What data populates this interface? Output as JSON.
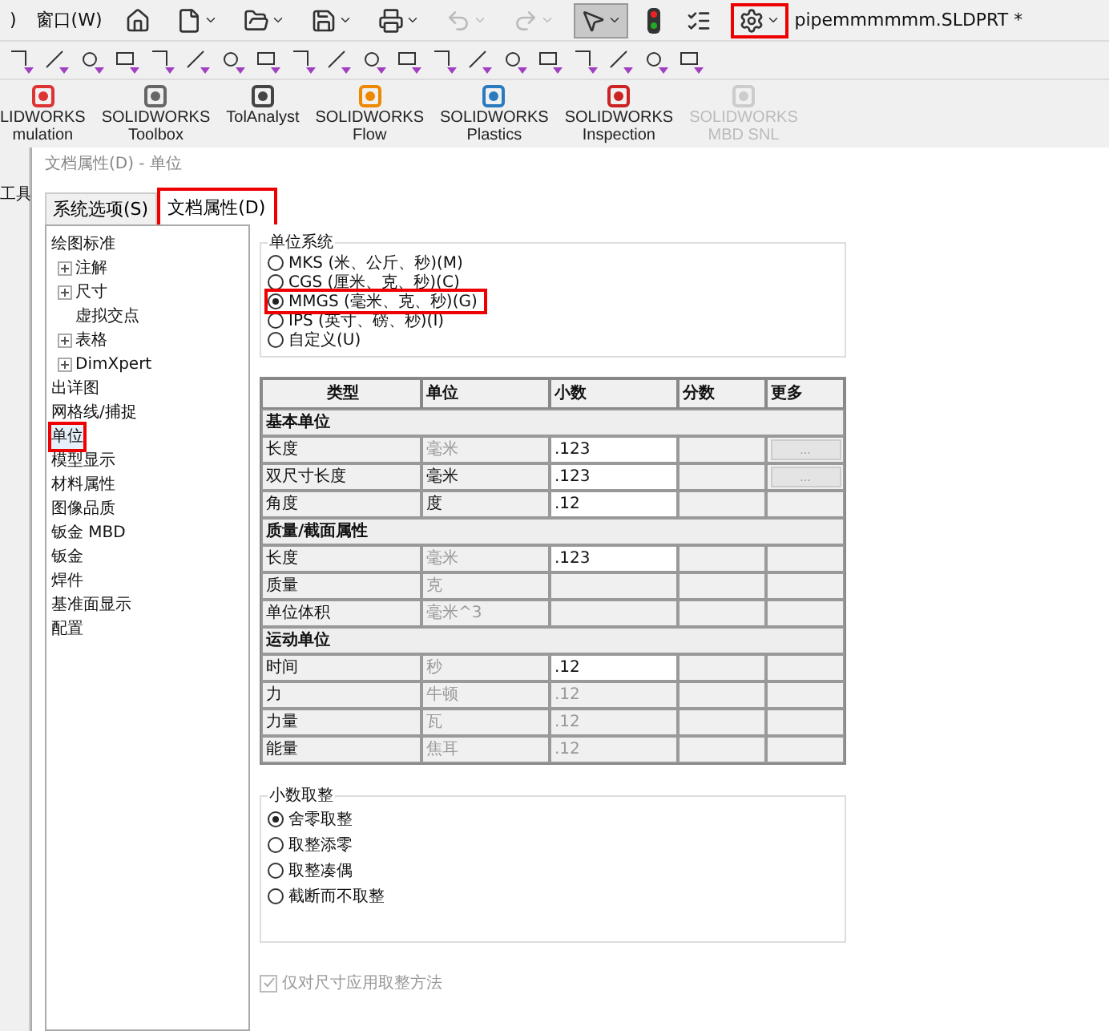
{
  "menu": [
    {
      "label": ")"
    },
    {
      "label": "窗口(W)"
    }
  ],
  "toolbar": {
    "buttons": [
      {
        "kind": "home"
      },
      {
        "kind": "file",
        "dropdown": true
      },
      {
        "kind": "open",
        "dropdown": true
      },
      {
        "kind": "save",
        "dropdown": true
      },
      {
        "kind": "print",
        "dropdown": true
      },
      {
        "kind": "undo",
        "dropdown": true,
        "disabled": true
      },
      {
        "kind": "redo",
        "dropdown": true,
        "disabled": true
      },
      {
        "kind": "select",
        "dropdown": true,
        "pressed": true
      },
      {
        "kind": "traffic"
      },
      {
        "kind": "list"
      },
      {
        "kind": "settings",
        "dropdown": true,
        "highlighted": true
      }
    ]
  },
  "document_title": "pipemmmmmm.SLDPRT *",
  "commands": [
    {
      "line1": "LIDWORKS",
      "line2": "mulation",
      "disabled": false
    },
    {
      "line1": "SOLIDWORKS",
      "line2": "Toolbox",
      "disabled": false
    },
    {
      "line1": "TolAnalyst",
      "disabled": false
    },
    {
      "line1": "SOLIDWORKS",
      "line2": "Flow",
      "disabled": false
    },
    {
      "line1": "SOLIDWORKS",
      "line2": "Plastics",
      "disabled": false
    },
    {
      "line1": "SOLIDWORKS",
      "line2": "Inspection",
      "disabled": false
    },
    {
      "line1": "SOLIDWORKS",
      "line2": "MBD SNL",
      "disabled": true
    }
  ],
  "side_tab": "工具",
  "dialog": {
    "title": "文档属性(D) - 单位",
    "tabs": [
      {
        "label": "系统选项(S)",
        "selected": false,
        "highlighted": false
      },
      {
        "label": "文档属性(D)",
        "selected": true,
        "highlighted": true
      }
    ],
    "tree": [
      {
        "label": "绘图标准",
        "selected": false,
        "highlighted": false,
        "children": [
          {
            "label": "注解",
            "expandable": true
          },
          {
            "label": "尺寸",
            "expandable": true
          },
          {
            "label": "虚拟交点",
            "expandable": false
          },
          {
            "label": "表格",
            "expandable": true
          },
          {
            "label": "DimXpert",
            "expandable": true
          }
        ]
      },
      {
        "label": "出详图",
        "selected": false,
        "highlighted": false
      },
      {
        "label": "网格线/捕捉",
        "selected": false,
        "highlighted": false
      },
      {
        "label": "单位",
        "selected": true,
        "highlighted": true
      },
      {
        "label": "模型显示",
        "selected": false,
        "highlighted": false
      },
      {
        "label": "材料属性",
        "selected": false,
        "highlighted": false
      },
      {
        "label": "图像品质",
        "selected": false,
        "highlighted": false
      },
      {
        "label": "钣金 MBD",
        "selected": false,
        "highlighted": false
      },
      {
        "label": "钣金",
        "selected": false,
        "highlighted": false
      },
      {
        "label": "焊件",
        "selected": false,
        "highlighted": false
      },
      {
        "label": "基准面显示",
        "selected": false,
        "highlighted": false
      },
      {
        "label": "配置",
        "selected": false,
        "highlighted": false
      }
    ],
    "unit_system": {
      "title": "单位系统",
      "options": [
        {
          "label": "MKS (米、公斤、秒)(M)",
          "selected": false,
          "highlighted": false
        },
        {
          "label": "CGS (厘米、克、秒)(C)",
          "selected": false,
          "highlighted": false
        },
        {
          "label": "MMGS (毫米、克、秒)(G)",
          "selected": true,
          "highlighted": true
        },
        {
          "label": "IPS (英寸、磅、秒)(I)",
          "selected": false,
          "highlighted": false
        },
        {
          "label": "自定义(U)",
          "selected": false,
          "highlighted": false
        }
      ]
    },
    "table": {
      "columns": [
        "类型",
        "单位",
        "小数",
        "分数",
        "更多"
      ],
      "rows": [
        {
          "kind": "section",
          "label": "基本单位"
        },
        {
          "kind": "row",
          "type": "长度",
          "unit": "毫米",
          "unit_disabled": true,
          "decimal": ".123",
          "decimal_editable": true,
          "more_button": "..."
        },
        {
          "kind": "row",
          "type": "双尺寸长度",
          "unit": "毫米",
          "unit_disabled": false,
          "decimal": ".123",
          "decimal_editable": true,
          "more_button": "..."
        },
        {
          "kind": "row",
          "type": "角度",
          "unit": "度",
          "unit_disabled": false,
          "decimal": ".12",
          "decimal_editable": true
        },
        {
          "kind": "section",
          "label": "质量/截面属性"
        },
        {
          "kind": "row",
          "type": "长度",
          "unit": "毫米",
          "unit_disabled": true,
          "decimal": ".123",
          "decimal_editable": true
        },
        {
          "kind": "row",
          "type": "质量",
          "unit": "克",
          "unit_disabled": true
        },
        {
          "kind": "row",
          "type": "单位体积",
          "unit": "毫米^3",
          "unit_disabled": true
        },
        {
          "kind": "section",
          "label": "运动单位"
        },
        {
          "kind": "row",
          "type": "时间",
          "unit": "秒",
          "unit_disabled": true,
          "decimal": ".12",
          "decimal_editable": true
        },
        {
          "kind": "row",
          "type": "力",
          "unit": "牛顿",
          "unit_disabled": true,
          "decimal": ".12",
          "decimal_editable": false
        },
        {
          "kind": "row",
          "type": "力量",
          "unit": "瓦",
          "unit_disabled": true,
          "decimal": ".12",
          "decimal_editable": false
        },
        {
          "kind": "row",
          "type": "能量",
          "unit": "焦耳",
          "unit_disabled": true,
          "decimal": ".12",
          "decimal_editable": false
        }
      ]
    },
    "rounding": {
      "title": "小数取整",
      "options": [
        {
          "label": "舍零取整",
          "selected": true
        },
        {
          "label": "取整添零",
          "selected": false
        },
        {
          "label": "取整凑偶",
          "selected": false
        },
        {
          "label": "截断而不取整",
          "selected": false
        }
      ]
    },
    "apply_only_dimensions": {
      "label": "仅对尺寸应用取整方法",
      "checked": true,
      "disabled": true
    }
  }
}
